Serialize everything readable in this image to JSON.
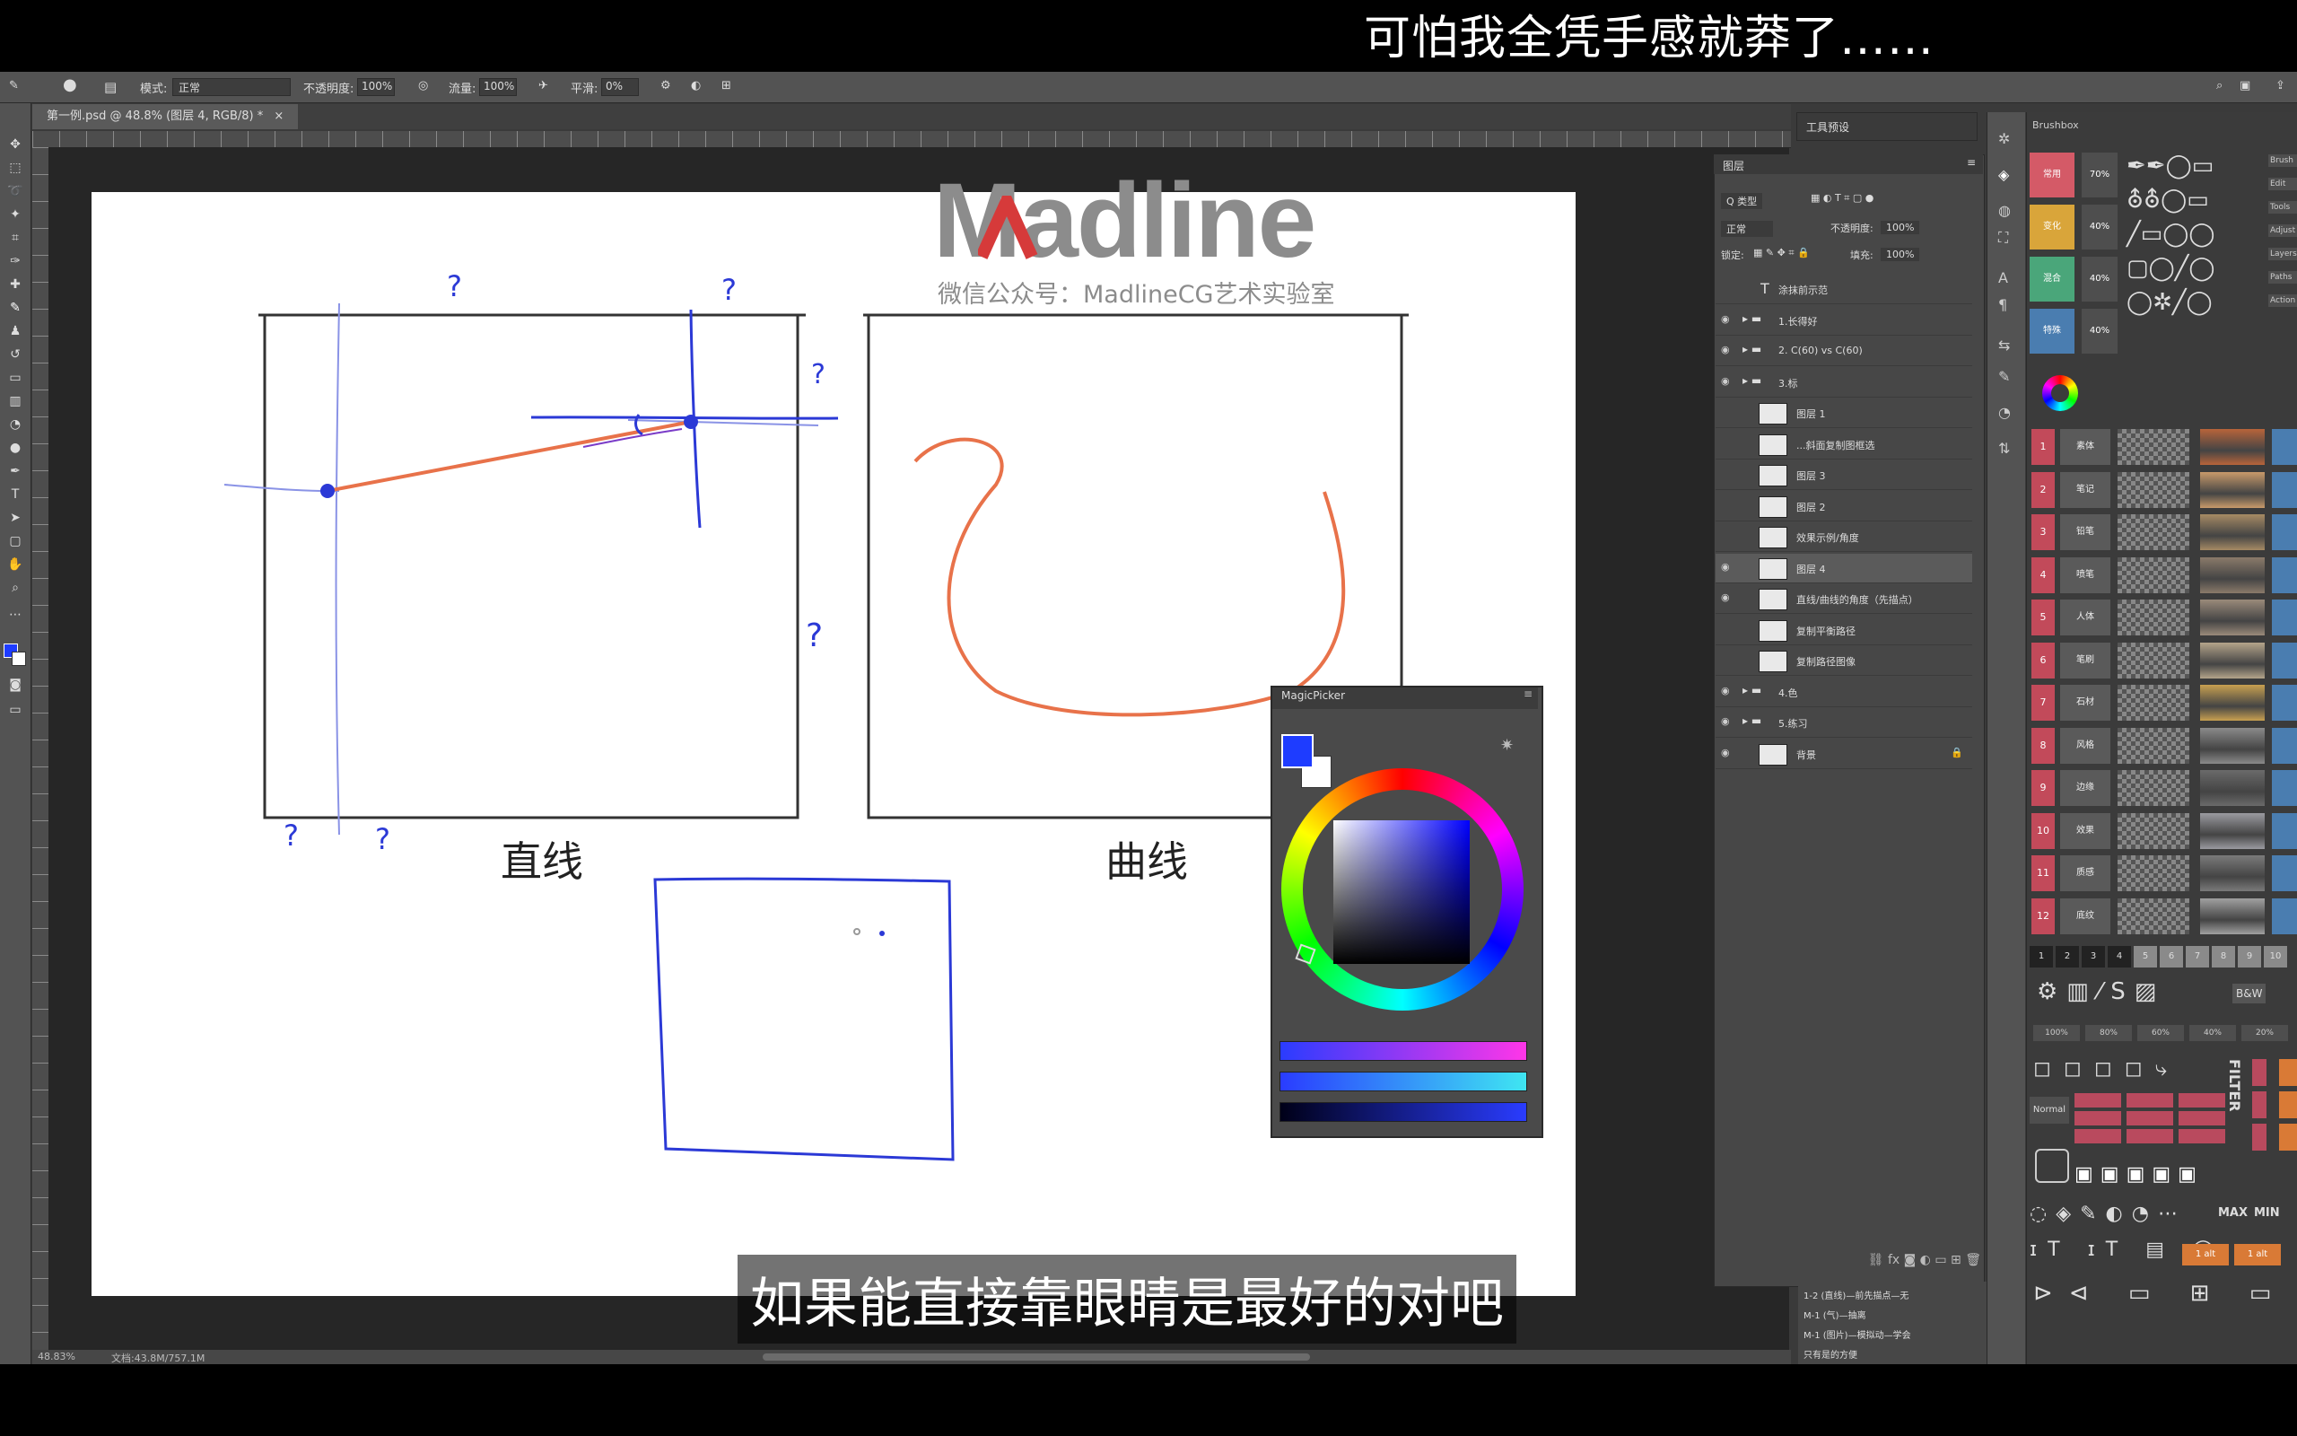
{
  "subtitles": {
    "top": "可怕我全凭手感就莽了……",
    "bottom": "如果能直接靠眼睛是最好的对吧"
  },
  "options_bar": {
    "mode_label": "模式:",
    "mode_value": "正常",
    "opacity_label": "不透明度:",
    "opacity_value": "100%",
    "flow_label": "流量:",
    "flow_value": "100%",
    "smoothing_label": "平滑:",
    "smoothing_value": "0%"
  },
  "document": {
    "tab_title": "第一例.psd @ 48.8% (图层 4, RGB/8) *",
    "zoom": "48.83%",
    "doc_size": "文档:43.8M/757.1M"
  },
  "watermark": {
    "logo": "Madline",
    "subtitle": "微信公众号：MadlineCG艺术实验室"
  },
  "canvas": {
    "caption_straight": "直线",
    "caption_curve": "曲线",
    "question_mark": "?"
  },
  "layers_panel": {
    "title": "图层",
    "kind_filter": "Q 类型",
    "blend_mode": "正常",
    "opacity_label": "不透明度:",
    "opacity_value": "100%",
    "lock_label": "锁定:",
    "fill_label": "填充:",
    "fill_value": "100%",
    "layers": [
      {
        "name": "涂抹前示范",
        "kind": "text",
        "visible": false
      },
      {
        "name": "1.长得好",
        "kind": "folder",
        "visible": true
      },
      {
        "name": "2. C(60) vs C(60)",
        "kind": "folder",
        "visible": true
      },
      {
        "name": "3.标",
        "kind": "folder",
        "visible": true
      },
      {
        "name": "图层 1",
        "kind": "layer",
        "visible": false
      },
      {
        "name": "...斜面复制图框选",
        "kind": "layer",
        "visible": false
      },
      {
        "name": "图层 3",
        "kind": "layer",
        "visible": false
      },
      {
        "name": "图层 2",
        "kind": "layer",
        "visible": false
      },
      {
        "name": "效果示例/角度",
        "kind": "layer",
        "visible": false
      },
      {
        "name": "图层 4",
        "kind": "layer",
        "visible": true,
        "selected": true
      },
      {
        "name": "直线/曲线的角度（先描点）",
        "kind": "layer",
        "visible": true
      },
      {
        "name": "复制平衡路径",
        "kind": "layer",
        "visible": false
      },
      {
        "name": "复制路径图像",
        "kind": "layer",
        "visible": false
      },
      {
        "name": "4.色",
        "kind": "folder",
        "visible": true
      },
      {
        "name": "5.练习",
        "kind": "folder",
        "visible": true
      },
      {
        "name": "背景",
        "kind": "background",
        "visible": true
      }
    ]
  },
  "properties_strip": {
    "title": "工具预设"
  },
  "history": {
    "items": [
      "1-2 (直线)—前先描点—无",
      "M-1 (气)—抽离",
      "M-1 (图片)—模拟动—学会",
      "只有是的方便"
    ]
  },
  "brushbox": {
    "title": "Brushbox",
    "color_swatches": [
      {
        "label": "常用",
        "color": "#d45a67"
      },
      {
        "label": "变化",
        "color": "#d9a53a"
      },
      {
        "label": "混合",
        "color": "#4aa67a"
      },
      {
        "label": "特殊",
        "color": "#4a7db0"
      }
    ],
    "swatch_values": [
      "70%",
      "40%",
      "40%",
      "40%"
    ],
    "slot_numbers": [
      "1",
      "2",
      "3",
      "4",
      "5",
      "6",
      "7",
      "8",
      "9",
      "10",
      "11",
      "12"
    ],
    "slot_labels": [
      "素体",
      "笔记",
      "铅笔",
      "喷笔",
      "人体",
      "笔刷",
      "石材",
      "风格",
      "边缘",
      "效果",
      "质感",
      "底纹"
    ],
    "side_labels": [
      "Brush",
      "Edit",
      "Tools",
      "Adjust",
      "Layers",
      "Paths",
      "Action"
    ],
    "filter_label": "FILTER",
    "normal_label": "Normal",
    "bw_label": "B&W",
    "max_label": "MAX",
    "min_label": "MIN",
    "pct_row": [
      "100%",
      "80%",
      "60%",
      "40%",
      "20%"
    ],
    "bottom_labels": [
      "1 alt",
      "1 alt"
    ],
    "page_numbers": [
      "1",
      "2",
      "3",
      "4",
      "5",
      "6",
      "7",
      "8",
      "9",
      "10"
    ]
  },
  "magic_picker": {
    "title": "MagicPicker",
    "foreground": "#1e3cff",
    "background": "#ffffff",
    "sliders": [
      {
        "name": "hue",
        "from": "#2a3cff",
        "to": "#ff36e8"
      },
      {
        "name": "saturation",
        "from": "#2a3cff",
        "to": "#3fe6f2"
      },
      {
        "name": "brightness",
        "from": "#000018",
        "to": "#2a3cff"
      }
    ]
  },
  "colors": {
    "accent_red": "#e8724a",
    "ink_blue": "#2b39d6",
    "pencil_blue": "#8a93e6"
  }
}
